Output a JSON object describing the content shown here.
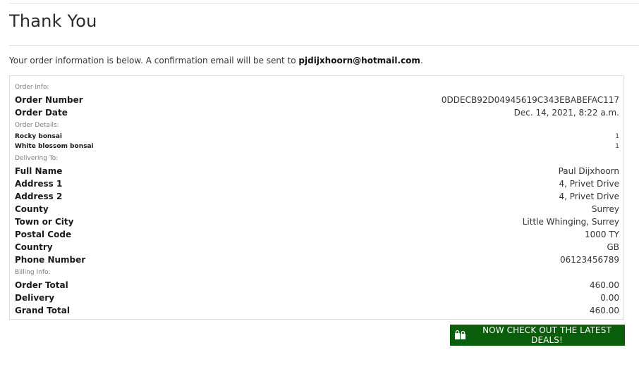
{
  "page": {
    "title": "Thank You",
    "intro_text": "Your order information is below. A confirmation email will be sent to ",
    "email": "pjdijxhoorn@hotmail.com",
    "intro_end": "."
  },
  "order_info": {
    "section_label": "Order Info:",
    "rows": [
      {
        "label": "Order Number",
        "value": "0DDECB92D04945619C343EBABEFAC117"
      },
      {
        "label": "Order Date",
        "value": "Dec. 14, 2021, 8:22 a.m."
      }
    ]
  },
  "order_details": {
    "section_label": "Order Details:",
    "items": [
      {
        "name": "Rocky bonsai",
        "qty": "1"
      },
      {
        "name": "White blossom bonsai",
        "qty": "1"
      }
    ]
  },
  "delivering_to": {
    "section_label": "Delivering To:",
    "rows": [
      {
        "label": "Full Name",
        "value": "Paul Dijxhoorn"
      },
      {
        "label": "Address 1",
        "value": "4, Privet Drive"
      },
      {
        "label": "Address 2",
        "value": "4, Privet Drive"
      },
      {
        "label": "County",
        "value": "Surrey"
      },
      {
        "label": "Town or City",
        "value": "Little Whinging, Surrey"
      },
      {
        "label": "Postal Code",
        "value": "1000 TY"
      },
      {
        "label": "Country",
        "value": "GB"
      },
      {
        "label": "Phone Number",
        "value": "06123456789"
      }
    ]
  },
  "billing_info": {
    "section_label": "Billing Info:",
    "rows": [
      {
        "label": "Order Total",
        "value": "460.00"
      },
      {
        "label": "Delivery",
        "value": "0.00"
      },
      {
        "label": "Grand Total",
        "value": "460.00"
      }
    ]
  },
  "cta": {
    "label": "NOW CHECK OUT THE LATEST DEALS!",
    "icon": "shopping-bags-icon",
    "background": "#0a5d0a"
  }
}
